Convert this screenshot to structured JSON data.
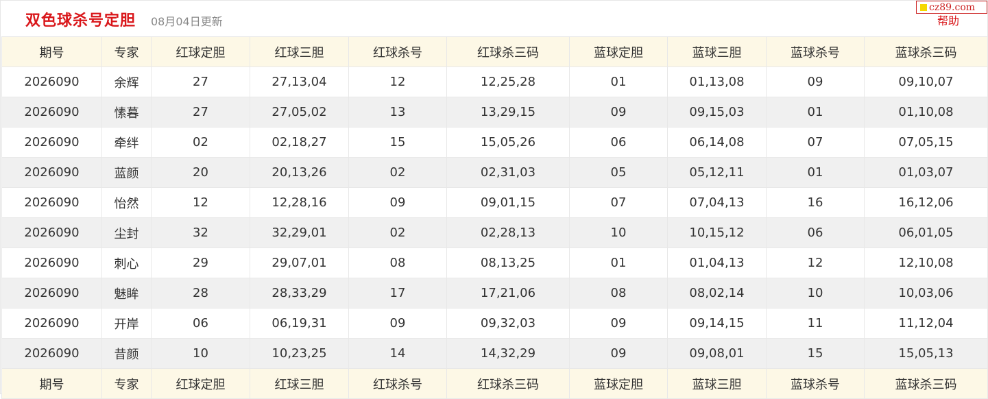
{
  "header": {
    "title": "双色球杀号定胆",
    "update": "08月04日更新",
    "help": "帮助",
    "watermark": "cz89.com"
  },
  "columns": [
    "期号",
    "专家",
    "红球定胆",
    "红球三胆",
    "红球杀号",
    "红球杀三码",
    "蓝球定胆",
    "蓝球三胆",
    "蓝球杀号",
    "蓝球杀三码"
  ],
  "rows": [
    [
      "2026090",
      "余辉",
      "27",
      "27,13,04",
      "12",
      "12,25,28",
      "01",
      "01,13,08",
      "09",
      "09,10,07"
    ],
    [
      "2026090",
      "愫暮",
      "27",
      "27,05,02",
      "13",
      "13,29,15",
      "09",
      "09,15,03",
      "01",
      "01,10,08"
    ],
    [
      "2026090",
      "牵绊",
      "02",
      "02,18,27",
      "15",
      "15,05,26",
      "06",
      "06,14,08",
      "07",
      "07,05,15"
    ],
    [
      "2026090",
      "蓝颜",
      "20",
      "20,13,26",
      "02",
      "02,31,03",
      "05",
      "05,12,11",
      "01",
      "01,03,07"
    ],
    [
      "2026090",
      "怡然",
      "12",
      "12,28,16",
      "09",
      "09,01,15",
      "07",
      "07,04,13",
      "16",
      "16,12,06"
    ],
    [
      "2026090",
      "尘封",
      "32",
      "32,29,01",
      "02",
      "02,28,13",
      "10",
      "10,15,12",
      "06",
      "06,01,05"
    ],
    [
      "2026090",
      "刺心",
      "29",
      "29,07,01",
      "08",
      "08,13,25",
      "01",
      "01,04,13",
      "12",
      "12,10,08"
    ],
    [
      "2026090",
      "魅眸",
      "28",
      "28,33,29",
      "17",
      "17,21,06",
      "08",
      "08,02,14",
      "10",
      "10,03,06"
    ],
    [
      "2026090",
      "开岸",
      "06",
      "06,19,31",
      "09",
      "09,32,03",
      "09",
      "09,14,15",
      "11",
      "11,12,04"
    ],
    [
      "2026090",
      "昔颜",
      "10",
      "10,23,25",
      "14",
      "14,32,29",
      "09",
      "09,08,01",
      "15",
      "15,05,13"
    ]
  ],
  "colors": {
    "title": "#d9161a",
    "header_bg": "#fdf8e6",
    "row_alt_bg": "#f0f0f0",
    "watermark_accent": "#f5d800"
  }
}
